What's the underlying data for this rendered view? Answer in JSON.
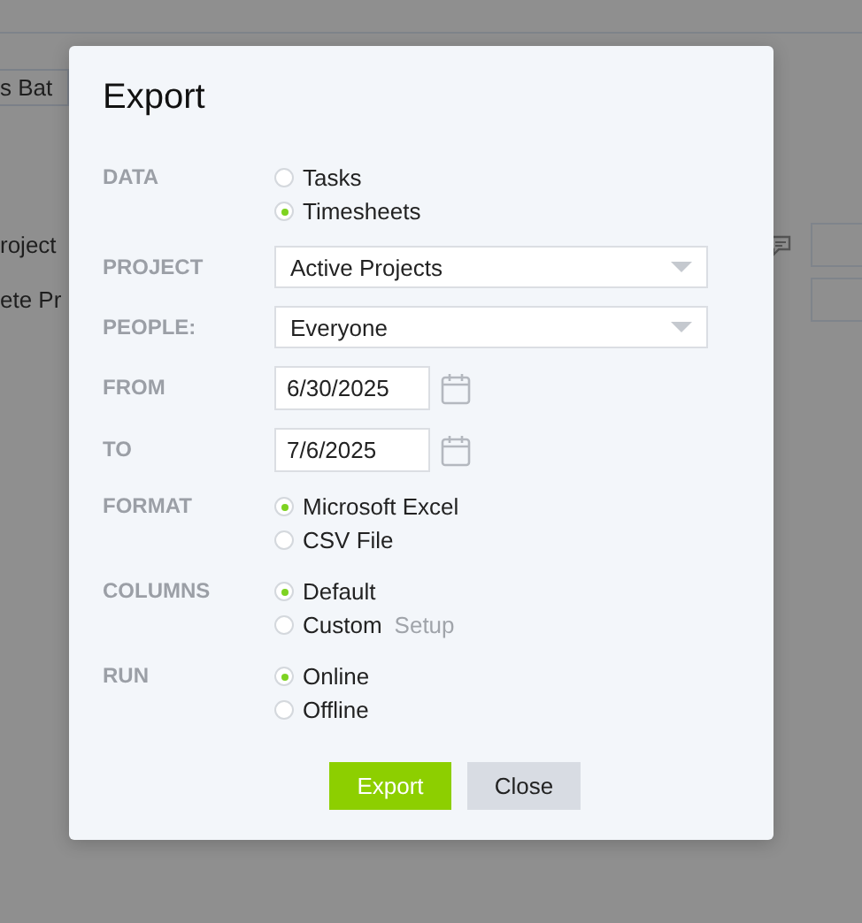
{
  "background": {
    "tab": "s Bat",
    "rows": [
      {
        "label": "roject",
        "comment_icon": true
      },
      {
        "label": "ete Pr",
        "comment_icon": false
      }
    ]
  },
  "dialog": {
    "title": "Export",
    "fields": [
      {
        "kind": "radio",
        "label": "DATA",
        "options": [
          {
            "label": "Tasks",
            "selected": false
          },
          {
            "label": "Timesheets",
            "selected": true
          }
        ]
      },
      {
        "kind": "select",
        "label": "PROJECT",
        "value": "Active Projects"
      },
      {
        "kind": "select",
        "label": "PEOPLE:",
        "value": "Everyone"
      },
      {
        "kind": "date",
        "label": "FROM",
        "value": "6/30/2025"
      },
      {
        "kind": "date",
        "label": "TO",
        "value": "7/6/2025"
      },
      {
        "kind": "radio",
        "label": "FORMAT",
        "options": [
          {
            "label": "Microsoft Excel",
            "selected": true
          },
          {
            "label": "CSV File",
            "selected": false
          }
        ]
      },
      {
        "kind": "radio",
        "label": "COLUMNS",
        "options": [
          {
            "label": "Default",
            "selected": true
          },
          {
            "label": "Custom",
            "selected": false,
            "link": "Setup"
          }
        ]
      },
      {
        "kind": "radio",
        "label": "RUN",
        "options": [
          {
            "label": "Online",
            "selected": true
          },
          {
            "label": "Offline",
            "selected": false
          }
        ]
      }
    ],
    "buttons": [
      {
        "label": "Export",
        "kind": "primary"
      },
      {
        "label": "Close",
        "kind": "secondary"
      }
    ]
  }
}
